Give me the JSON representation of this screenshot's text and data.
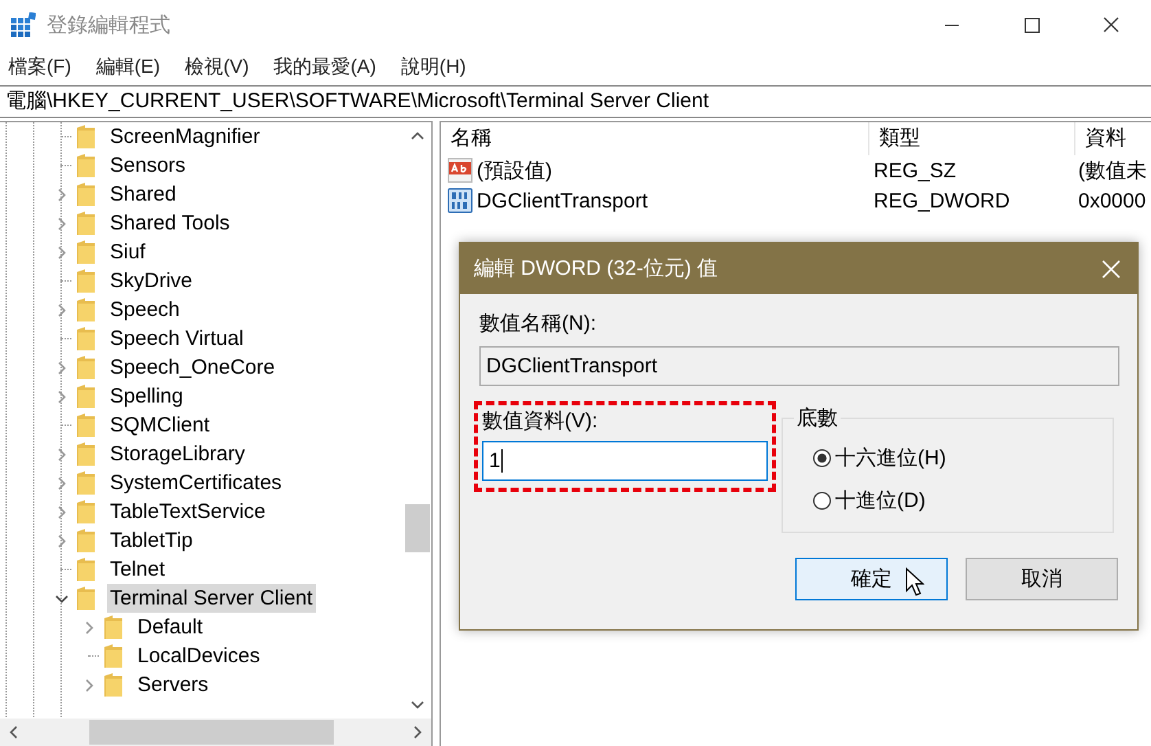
{
  "window": {
    "title": "登錄編輯程式"
  },
  "menu": [
    "檔案(F)",
    "編輯(E)",
    "檢視(V)",
    "我的最愛(A)",
    "說明(H)"
  ],
  "address": "電腦\\HKEY_CURRENT_USER\\SOFTWARE\\Microsoft\\Terminal Server Client",
  "tree": [
    {
      "label": "ScreenMagnifier",
      "has_children": false,
      "selected": false
    },
    {
      "label": "Sensors",
      "has_children": false,
      "selected": false
    },
    {
      "label": "Shared",
      "has_children": true,
      "expanded": false,
      "selected": false
    },
    {
      "label": "Shared Tools",
      "has_children": true,
      "expanded": false,
      "selected": false
    },
    {
      "label": "Siuf",
      "has_children": true,
      "expanded": false,
      "selected": false
    },
    {
      "label": "SkyDrive",
      "has_children": false,
      "selected": false
    },
    {
      "label": "Speech",
      "has_children": true,
      "expanded": false,
      "selected": false
    },
    {
      "label": "Speech Virtual",
      "has_children": false,
      "selected": false
    },
    {
      "label": "Speech_OneCore",
      "has_children": true,
      "expanded": false,
      "selected": false
    },
    {
      "label": "Spelling",
      "has_children": true,
      "expanded": false,
      "selected": false
    },
    {
      "label": "SQMClient",
      "has_children": false,
      "selected": false
    },
    {
      "label": "StorageLibrary",
      "has_children": true,
      "expanded": false,
      "selected": false
    },
    {
      "label": "SystemCertificates",
      "has_children": true,
      "expanded": false,
      "selected": false
    },
    {
      "label": "TableTextService",
      "has_children": true,
      "expanded": false,
      "selected": false
    },
    {
      "label": "TabletTip",
      "has_children": true,
      "expanded": false,
      "selected": false
    },
    {
      "label": "Telnet",
      "has_children": false,
      "selected": false
    },
    {
      "label": "Terminal Server Client",
      "has_children": true,
      "expanded": true,
      "selected": true,
      "children": [
        {
          "label": "Default",
          "has_children": true,
          "expanded": false,
          "selected": false
        },
        {
          "label": "LocalDevices",
          "has_children": false,
          "selected": false
        },
        {
          "label": "Servers",
          "has_children": true,
          "expanded": false,
          "selected": false
        }
      ]
    }
  ],
  "values_list": {
    "columns": [
      "名稱",
      "類型",
      "資料"
    ],
    "rows": [
      {
        "kind": "string",
        "name": "(預設值)",
        "type": "REG_SZ",
        "data": "(數值未"
      },
      {
        "kind": "dword",
        "name": "DGClientTransport",
        "type": "REG_DWORD",
        "data": "0x0000"
      }
    ]
  },
  "dialog": {
    "title": "編輯 DWORD (32-位元) 值",
    "name_label": "數值名稱(N):",
    "name_value": "DGClientTransport",
    "data_label": "數值資料(V):",
    "data_value": "1",
    "data_highlighted": true,
    "base": {
      "label": "底數",
      "options": [
        {
          "label": "十六進位(H)",
          "selected": true
        },
        {
          "label": "十進位(D)",
          "selected": false
        }
      ]
    },
    "buttons": [
      {
        "label": "確定",
        "default": true
      },
      {
        "label": "取消",
        "default": false
      }
    ]
  }
}
